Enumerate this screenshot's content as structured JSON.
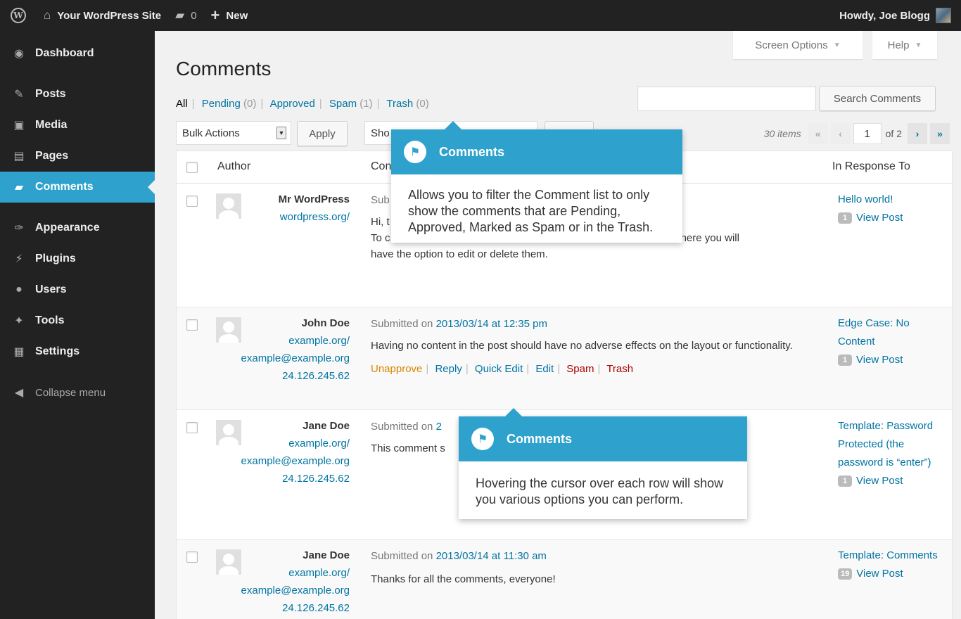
{
  "adminbar": {
    "logo": "W",
    "site_name": "Your WordPress Site",
    "comments_count": "0",
    "new_label": "New",
    "howdy": "Howdy, Joe Blogg"
  },
  "sidebar": {
    "items": [
      {
        "label": "Dashboard",
        "icon": "dashboard-icon"
      },
      {
        "label": "Posts",
        "icon": "pin-icon"
      },
      {
        "label": "Media",
        "icon": "media-icon"
      },
      {
        "label": "Pages",
        "icon": "pages-icon"
      },
      {
        "label": "Comments",
        "icon": "comment-icon"
      },
      {
        "label": "Appearance",
        "icon": "brush-icon"
      },
      {
        "label": "Plugins",
        "icon": "plug-icon"
      },
      {
        "label": "Users",
        "icon": "user-icon"
      },
      {
        "label": "Tools",
        "icon": "wrench-icon"
      },
      {
        "label": "Settings",
        "icon": "settings-icon"
      }
    ],
    "collapse_label": "Collapse menu"
  },
  "screen_options": "Screen Options",
  "help": "Help",
  "page_title": "Comments",
  "filters": {
    "all": "All",
    "pending": "Pending",
    "pending_count": "(0)",
    "approved": "Approved",
    "spam": "Spam",
    "spam_count": "(1)",
    "trash": "Trash",
    "trash_count": "(0)"
  },
  "search_button": "Search Comments",
  "bulk_actions": "Bulk Actions",
  "apply": "Apply",
  "show_all": "Sho",
  "pagination": {
    "items": "30 items",
    "first": "«",
    "prev": "‹",
    "current": "1",
    "of": "of 2",
    "next": "›",
    "last": "»"
  },
  "columns": {
    "author": "Author",
    "comment": "Con",
    "response": "In Response To"
  },
  "rows": [
    {
      "name": "Mr WordPress",
      "url": "wordpress.org/",
      "sub_prefix": "Sub",
      "lines": [
        "Hi, t",
        "To c",
        "have the option to edit or delete them."
      ],
      "tail": "mments. There you will",
      "response": "Hello world!",
      "bubble": "1",
      "view": "View Post"
    },
    {
      "name": "John Doe",
      "url": "example.org/",
      "email": "example@example.org",
      "ip": "24.126.245.62",
      "submitted": "Submitted on",
      "date": "2013/03/14 at 12:35 pm",
      "text": "Having no content in the post should have no adverse effects on the layout or functionality.",
      "actions": {
        "unapprove": "Unapprove",
        "reply": "Reply",
        "quick_edit": "Quick Edit",
        "edit": "Edit",
        "spam": "Spam",
        "trash": "Trash"
      },
      "response": "Edge Case: No Content",
      "bubble": "1",
      "view": "View Post"
    },
    {
      "name": "Jane Doe",
      "url": "example.org/",
      "email": "example@example.org",
      "ip": "24.126.245.62",
      "submitted": "Submitted on",
      "date_partial": "2",
      "text_partial": "This comment s",
      "response": "Template: Password Protected (the password is “enter”)",
      "bubble": "1",
      "view": "View Post"
    },
    {
      "name": "Jane Doe",
      "url": "example.org/",
      "email": "example@example.org",
      "ip": "24.126.245.62",
      "submitted": "Submitted on",
      "date": "2013/03/14 at 11:30 am",
      "text": "Thanks for all the comments, everyone!",
      "response": "Template: Comments",
      "bubble": "19",
      "view": "View Post"
    }
  ],
  "pointers": [
    {
      "title": "Comments",
      "body": "Allows you to filter the Comment list to only show the comments that are Pending, Approved, Marked as Spam or in the Trash."
    },
    {
      "title": "Comments",
      "body": "Hovering the cursor over each row will show you various options you can perform."
    }
  ],
  "colors": {
    "accent": "#2ea2cc",
    "link": "#0074a2",
    "sidebar": "#222222"
  }
}
